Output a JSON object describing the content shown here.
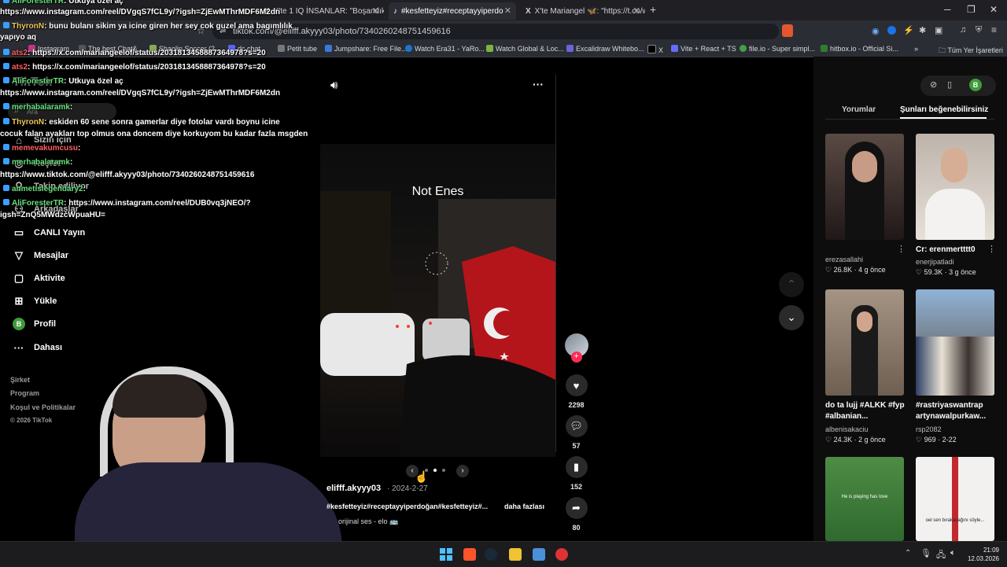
{
  "browser": {
    "tabs": [
      {
        "label": "X'te 1 IQ İNSANLAR: \"Boşandıktan so"
      },
      {
        "label": "#kesfetteyiz#receptayyiperdo"
      },
      {
        "label": "X'te Mariangel 🦋: \"https://t.co/w3b"
      }
    ],
    "url": "tiktok.com/@elifff.akyyy03/photo/7340260248751459616",
    "bookmarks": [
      "Instagram",
      "The best Chat&...",
      "Shaolin Soccer (2...",
      "dc chat",
      "Petit tube",
      "Jumpshare: Free File...",
      "Watch Era31 - YaRo...",
      "Watch Global & Loc...",
      "Excalidraw Whitebo...",
      "X",
      "Vite + React + TS",
      "file.io - Super simpl...",
      "hitbox.io - Official Si...",
      "Tüm Yer İşaretleri"
    ]
  },
  "tiktok": {
    "logo": "TikTok",
    "search": "Ara",
    "nav": [
      "Sizin için",
      "Keşfet",
      "Takip ediliyor",
      "Arkadaşlar",
      "CANLI Yayın",
      "Mesajlar",
      "Aktivite",
      "Yükle",
      "Profil",
      "Dahası"
    ],
    "profile_initial": "B",
    "footer": [
      "Şirket",
      "Program",
      "Koşul ve Politikalar",
      "© 2026 TikTok"
    ],
    "photo_caption_overlay": "Not Enes",
    "post": {
      "author": "elifff.akyyy03",
      "date": "· 2024-2-27",
      "caption": "#kesfetteyiz#receptayyiperdoğan#kesfetteyiz#...",
      "more": "daha fazlası",
      "sound": "orijinal ses - elo 🚌"
    },
    "actions": {
      "likes": "2298",
      "comments": "57",
      "saves": "152",
      "shares": "80"
    },
    "tabs": [
      "Yorumlar",
      "Şunları beğenebilirsiniz"
    ],
    "cards": [
      {
        "title": "",
        "user": "erezasallahi",
        "likes": "26.8K",
        "ago": "4 g önce",
        "color": "#3a2b26"
      },
      {
        "title": "Cr: erenmertttt0",
        "user": "enerjipatladi",
        "likes": "59.3K",
        "ago": "3 g önce",
        "color": "#c9bfb4"
      },
      {
        "title": "do ta lujj #ALKK #fyp #albanian...",
        "user": "albenisakaciu",
        "likes": "24.3K",
        "ago": "2 g önce",
        "color": "#8b7a6c"
      },
      {
        "title": "#rastriyaswantrap artynawalpurkaw...",
        "user": "rsp2082",
        "likes": "969",
        "ago": "2-22",
        "color": "#7c8da0"
      },
      {
        "title": "",
        "user": "",
        "likes": "",
        "ago": "",
        "color": "#3f7a3a"
      },
      {
        "title": "",
        "user": "",
        "likes": "",
        "ago": "",
        "color": "#f3f1f0"
      }
    ],
    "card_overlay_texts": [
      "He is playing has Iove",
      "oel sen bırakacağını söyle..."
    ]
  },
  "chat": [
    {
      "user": "AliForesterTR",
      "msg": ": Utkuya özel aç"
    },
    {
      "user": "",
      "msg": "https://www.instagram.com/reel/DVgqS7fCL9y/?igsh=ZjEwMThrMDF6M2dn"
    },
    {
      "user": "ThyronN",
      "msg": ": bunu bulanı sikim ya icine giren her sey cok guzel ama bagımlılık"
    },
    {
      "user": "",
      "msg": "yapıyo aq"
    },
    {
      "user": "ats2",
      "msg": ": https://x.com/mariangeelof/status/2031813458887364978?s=20"
    },
    {
      "user": "ats2",
      "msg": ": https://x.com/mariangeelof/status/2031813458887364978?s=20"
    },
    {
      "user": "AliForesterTR",
      "msg": ": Utkuya özel aç"
    },
    {
      "user": "",
      "msg": "https://www.instagram.com/reel/DVgqS7fCL9y/?igsh=ZjEwMThrMDF6M2dn"
    },
    {
      "user": "merhabalaramk",
      "msg": ":"
    },
    {
      "user": "ThyronN",
      "msg": ": eskiden 60 sene sonra gamerlar diye fotolar vardı boynu icine"
    },
    {
      "user": "",
      "msg": "cocuk falan ayakları top olmus ona doncem diye korkuyom bu kadar fazla msgden"
    },
    {
      "user": "memevakumcusu",
      "msg": ":"
    },
    {
      "user": "merhabalaramk",
      "msg": ":"
    },
    {
      "user": "",
      "msg": "https://www.tiktok.com/@elifff.akyyy03/photo/7340260248751459616"
    },
    {
      "user": "ahmetislegendary2",
      "msg": ":"
    },
    {
      "user": "AliForesterTR",
      "msg": ": https://www.instagram.com/reel/DUB0vq3jNEO/?"
    },
    {
      "user": "",
      "msg": "igsh=ZnQ5MWdzcWpuaHU="
    }
  ],
  "taskbar": {
    "time": "21:09",
    "date": "12.03.2026"
  },
  "colors": {
    "accent": "#fe2c55",
    "profile": "#3f9c38",
    "background": "#000000"
  }
}
